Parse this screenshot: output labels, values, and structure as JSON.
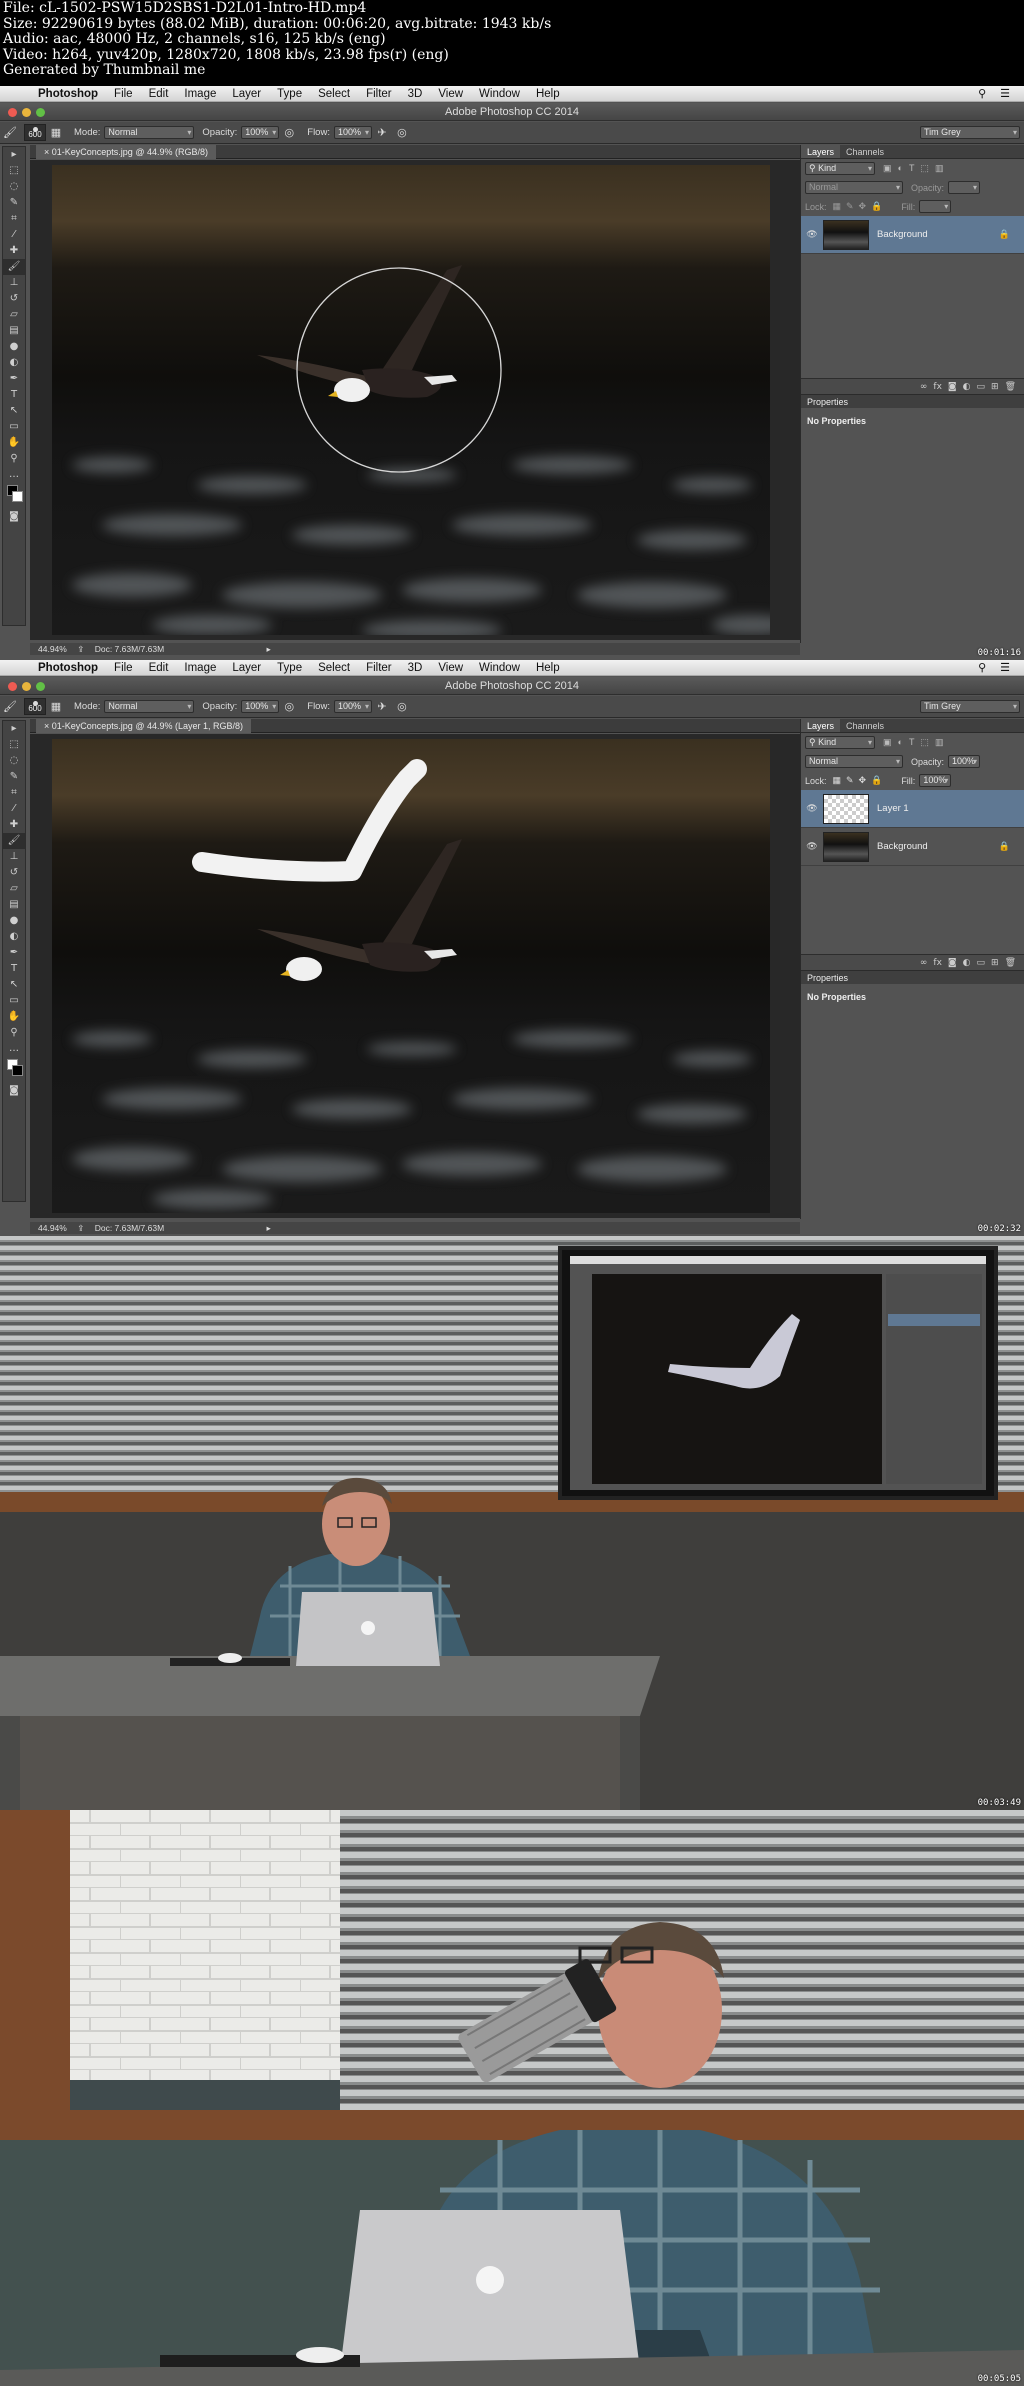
{
  "meta_header": {
    "line1": "File: cL-1502-PSW15D2SBS1-D2L01-Intro-HD.mp4",
    "line2": "Size: 92290619 bytes (88.02 MiB), duration: 00:06:20, avg.bitrate: 1943 kb/s",
    "line3": "Audio: aac, 48000 Hz, 2 channels, s16, 125 kb/s (eng)",
    "line4": "Video: h264, yuv420p, 1280x720, 1808 kb/s, 23.98 fps(r) (eng)",
    "line5": "Generated by Thumbnail me"
  },
  "photoshop": {
    "menu": [
      "Photoshop",
      "File",
      "Edit",
      "Image",
      "Layer",
      "Type",
      "Select",
      "Filter",
      "3D",
      "View",
      "Window",
      "Help"
    ],
    "window_title": "Adobe Photoshop CC 2014",
    "user": "Tim Grey",
    "options": {
      "mode_label": "Mode:",
      "mode_value": "Normal",
      "opacity_label": "Opacity:",
      "opacity_value": "100%",
      "flow_label": "Flow:",
      "flow_value": "100%",
      "brush_size": "600"
    },
    "panel_tabs": {
      "layers": "Layers",
      "channels": "Channels"
    },
    "kind_label": "Kind",
    "blend_mode": "Normal",
    "opacity_label": "Opacity:",
    "opacity_value": "100%",
    "lock_label": "Lock:",
    "fill_label": "Fill:",
    "fill_value": "100%",
    "properties_title": "Properties",
    "no_properties": "No Properties"
  },
  "frame1": {
    "tab_title": "01-KeyConcepts.jpg @ 44.9% (RGB/8)",
    "zoom": "44.94%",
    "doc": "Doc: 7.63M/7.63M",
    "layers": [
      {
        "name": "Background",
        "locked": true,
        "active": true
      }
    ],
    "timestamp": "00:01:16"
  },
  "frame2": {
    "tab_title": "01-KeyConcepts.jpg @ 44.9% (Layer 1, RGB/8)",
    "zoom": "44.94%",
    "doc": "Doc: 7.63M/7.63M",
    "layers": [
      {
        "name": "Layer 1",
        "locked": false,
        "active": true
      },
      {
        "name": "Background",
        "locked": true,
        "active": false
      }
    ],
    "timestamp": "00:02:32"
  },
  "frame3": {
    "timestamp": "00:03:49"
  },
  "frame4": {
    "timestamp": "00:05:05"
  },
  "colors": {
    "active_layer": "#5f7893",
    "ps_panel": "#535353",
    "ps_dark": "#282828"
  }
}
